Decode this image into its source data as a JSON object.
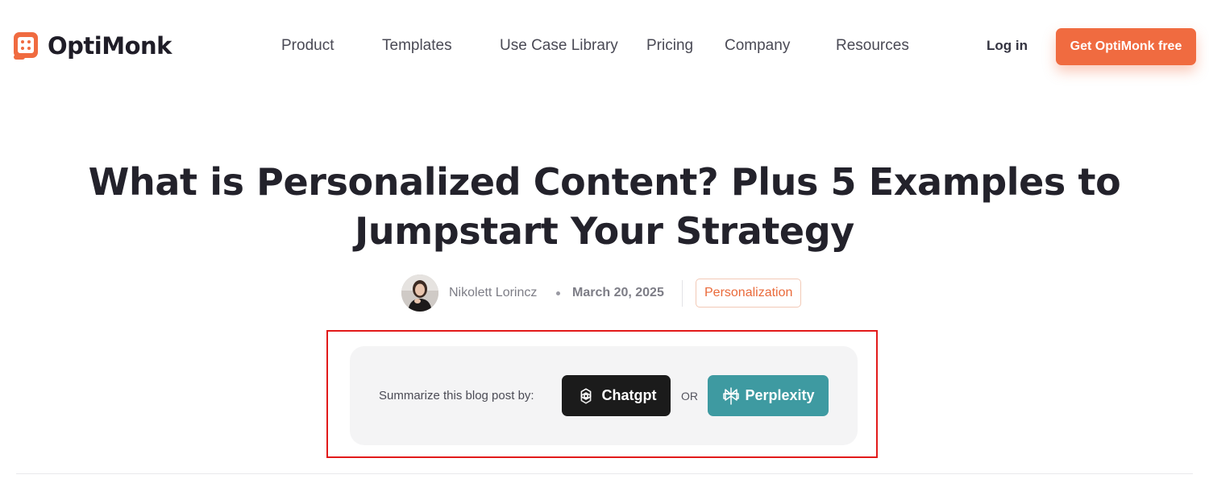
{
  "brand": {
    "name": "OptiMonk",
    "accent_color": "#f06b40"
  },
  "nav": {
    "items": [
      {
        "label": "Product"
      },
      {
        "label": "Templates"
      },
      {
        "label": "Use Case Library"
      },
      {
        "label": "Pricing"
      },
      {
        "label": "Company"
      },
      {
        "label": "Resources"
      }
    ],
    "login_label": "Log in",
    "cta_label": "Get OptiMonk free"
  },
  "article": {
    "title_line1": "What is Personalized Content? Plus 5 Examples to",
    "title_line2": "Jumpstart Your Strategy",
    "author": "Nikolett Lorincz",
    "date": "March 20, 2025",
    "tag": "Personalization"
  },
  "summarize": {
    "label": "Summarize this blog post by:",
    "chatgpt_label": "Chatgpt",
    "or_label": "OR",
    "perplexity_label": "Perplexity",
    "chatgpt_color": "#1b1b1b",
    "perplexity_color": "#3e9aa1",
    "highlight_color": "#e21a1a"
  }
}
